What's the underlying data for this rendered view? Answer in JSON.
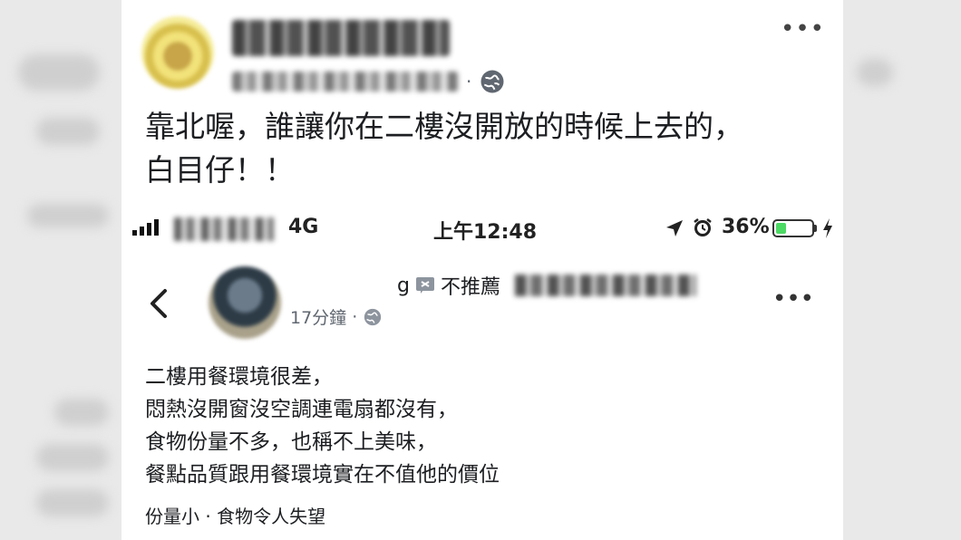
{
  "top_post": {
    "more_label": "•••",
    "meta_separator": "·",
    "text_lines": [
      "靠北喔，誰讓你在二樓沒開放的時候上去的，",
      "白目仔！！"
    ]
  },
  "status_bar": {
    "network": "4G",
    "time": "上午12:48",
    "battery_percent": "36%",
    "battery_level": 0.36
  },
  "review_post": {
    "page_fragment": "g",
    "recommendation": "不推薦",
    "time_ago": "17分鐘",
    "meta_separator": "·",
    "more_label": "•••",
    "body_lines": [
      "二樓用餐環境很差，",
      "悶熱沒開窗沒空調連電扇都沒有，",
      "食物份量不多，也稱不上美味，",
      "餐點品質跟用餐環境實在不值他的價位"
    ],
    "tags": "份量小 · 食物令人失望"
  },
  "colors": {
    "battery_green": "#4cd964",
    "text_primary": "#1c1e21",
    "text_secondary": "#606770"
  }
}
